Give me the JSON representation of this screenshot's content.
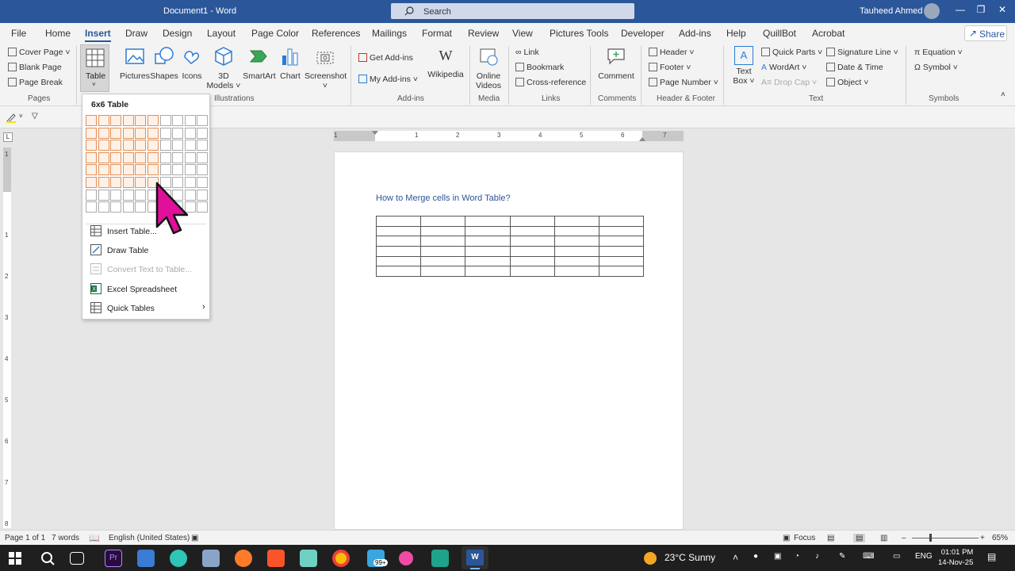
{
  "titlebar": {
    "doc": "Document1  -  Word",
    "search_placeholder": "Search",
    "user": "Tauheed Ahmed"
  },
  "menu": [
    "File",
    "Home",
    "Insert",
    "Draw",
    "Design",
    "Layout",
    "Page Color",
    "References",
    "Mailings",
    "Format",
    "Review",
    "View",
    "Pictures Tools",
    "Developer",
    "Add-ins",
    "Help",
    "QuillBot",
    "Acrobat"
  ],
  "share": "Share",
  "ribbon": {
    "pages": {
      "cover": "Cover Page",
      "blank": "Blank Page",
      "break": "Page Break",
      "label": "Pages"
    },
    "table": "Table",
    "illus": {
      "pictures": "Pictures",
      "shapes": "Shapes",
      "icons": "Icons",
      "models": "3D",
      "models2": "Models",
      "smartart": "SmartArt",
      "chart": "Chart",
      "screenshot": "Screenshot",
      "label": "Illustrations"
    },
    "addins": {
      "get": "Get Add-ins",
      "my": "My Add-ins",
      "wiki": "Wikipedia",
      "label": "Add-ins"
    },
    "media": {
      "online": "Online",
      "videos": "Videos",
      "label": "Media"
    },
    "links": {
      "link": "Link",
      "bookmark": "Bookmark",
      "cross": "Cross-reference",
      "label": "Links"
    },
    "comments": {
      "comment": "Comment",
      "label": "Comments"
    },
    "hf": {
      "header": "Header",
      "footer": "Footer",
      "pagenum": "Page Number",
      "label": "Header & Footer"
    },
    "text": {
      "textbox": "Text",
      "textbox2": "Box",
      "quick": "Quick Parts",
      "wordart": "WordArt",
      "dropcap": "Drop Cap",
      "sig": "Signature Line",
      "date": "Date & Time",
      "object": "Object",
      "label": "Text"
    },
    "symbols": {
      "equation": "Equation",
      "symbol": "Symbol",
      "label": "Symbols"
    }
  },
  "dropdown": {
    "title": "6x6 Table",
    "items": [
      "Insert Table...",
      "Draw Table",
      "Convert Text to Table...",
      "Excel Spreadsheet",
      "Quick Tables"
    ]
  },
  "ruler": [
    "1",
    "1",
    "2",
    "3",
    "4",
    "5",
    "6",
    "7"
  ],
  "vruler": [
    "1",
    "1",
    "2",
    "3",
    "4",
    "5",
    "6",
    "7",
    "8"
  ],
  "document": {
    "heading": "How to Merge cells in Word Table?",
    "rows": 6,
    "cols": 6
  },
  "status": {
    "page": "Page 1 of 1",
    "words": "7 words",
    "lang": "English (United States)",
    "focus": "Focus",
    "zoom": "65%"
  },
  "taskbar": {
    "weather": "23°C  Sunny",
    "badge": "99+",
    "lang": "ENG",
    "time": "01:01 PM",
    "date": "14-Nov-25"
  },
  "colors": {
    "accent": "#2b579a",
    "selection": "#e38f55",
    "cursor": "#e0109a"
  }
}
